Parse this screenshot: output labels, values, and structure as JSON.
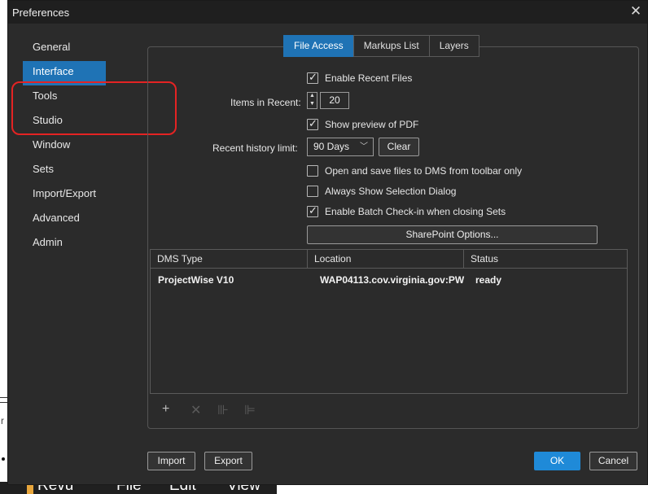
{
  "window": {
    "title": "Preferences",
    "close_glyph": "✕"
  },
  "background_app": {
    "menu_items": [
      "Revu",
      "File",
      "Edit",
      "View"
    ],
    "left_fragment_glyph": "r"
  },
  "sidebar": {
    "items": [
      {
        "label": "General",
        "active": false
      },
      {
        "label": "Interface",
        "active": true
      },
      {
        "label": "Tools",
        "active": false
      },
      {
        "label": "Studio",
        "active": false
      },
      {
        "label": "Window",
        "active": false
      },
      {
        "label": "Sets",
        "active": false
      },
      {
        "label": "Import/Export",
        "active": false
      },
      {
        "label": "Advanced",
        "active": false
      },
      {
        "label": "Admin",
        "active": false
      }
    ],
    "annotation_color": "#e42323"
  },
  "tabs": [
    {
      "label": "File Access",
      "active": true
    },
    {
      "label": "Markups List",
      "active": false
    },
    {
      "label": "Layers",
      "active": false
    }
  ],
  "file_access": {
    "enable_recent_files": {
      "label": "Enable Recent Files",
      "checked": true
    },
    "items_in_recent": {
      "label": "Items in Recent:",
      "value": "20"
    },
    "show_preview": {
      "label": "Show preview of PDF",
      "checked": true
    },
    "recent_history_limit": {
      "label": "Recent history limit:",
      "value": "90 Days",
      "clear_label": "Clear"
    },
    "open_save_dms": {
      "label": "Open and save files to DMS from toolbar only",
      "checked": false
    },
    "always_show_selection": {
      "label": "Always Show Selection Dialog",
      "checked": false
    },
    "enable_batch_checkin": {
      "label": "Enable Batch Check-in when closing Sets",
      "checked": true
    },
    "sharepoint_button": "SharePoint Options..."
  },
  "dms_table": {
    "columns": [
      "DMS Type",
      "Location",
      "Status"
    ],
    "rows": [
      {
        "type": "ProjectWise V10",
        "location": "WAP04113.cov.virginia.gov:PW",
        "status": "ready"
      }
    ]
  },
  "table_toolbar": [
    {
      "icon": "plus-icon",
      "glyph": "+",
      "enabled": true
    },
    {
      "icon": "remove-icon",
      "glyph": "✕",
      "enabled": false
    },
    {
      "icon": "check-out-icon",
      "glyph": "⊪",
      "enabled": false
    },
    {
      "icon": "check-in-icon",
      "glyph": "⊫",
      "enabled": false
    }
  ],
  "footer": {
    "import_label": "Import",
    "export_label": "Export",
    "ok_label": "OK",
    "cancel_label": "Cancel"
  },
  "colors": {
    "accent": "#1f73b5",
    "dialog_bg": "#2b2b2b",
    "primary_button": "#1f8ad8"
  }
}
